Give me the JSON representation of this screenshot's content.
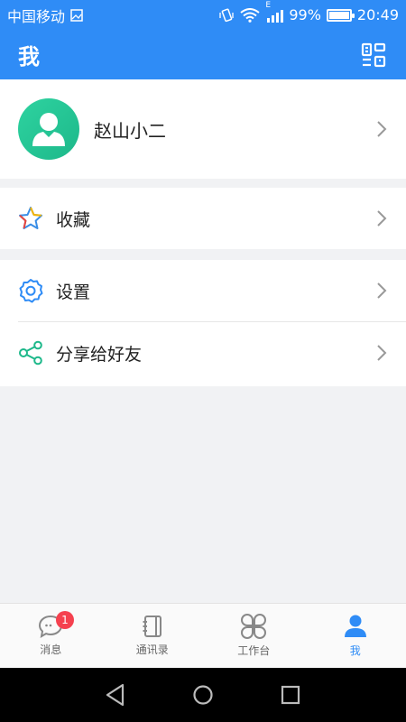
{
  "status_bar": {
    "carrier": "中国移动",
    "battery_percent": "99%",
    "battery_level": 0.99,
    "time": "20:49",
    "network_type": "E",
    "icons": [
      "image-icon",
      "vibrate-icon",
      "wifi-icon",
      "signal-icon",
      "battery-icon"
    ]
  },
  "header": {
    "title": "我",
    "action_icon": "qr-code-icon"
  },
  "profile": {
    "name": "赵山小二",
    "avatar_icon": "user-avatar-icon"
  },
  "menu": {
    "favorites_label": "收藏",
    "settings_label": "设置",
    "share_label": "分享给好友"
  },
  "bottom_nav": {
    "items": [
      {
        "label": "消息",
        "icon": "chat-bubble-icon",
        "badge": "1"
      },
      {
        "label": "通讯录",
        "icon": "contacts-book-icon"
      },
      {
        "label": "工作台",
        "icon": "workbench-grid-icon"
      },
      {
        "label": "我",
        "icon": "profile-person-icon",
        "active": true
      }
    ]
  },
  "colors": {
    "primary": "#2f8cf6",
    "avatar": "#1db88a",
    "badge": "#f5414f",
    "background": "#f1f2f4"
  }
}
